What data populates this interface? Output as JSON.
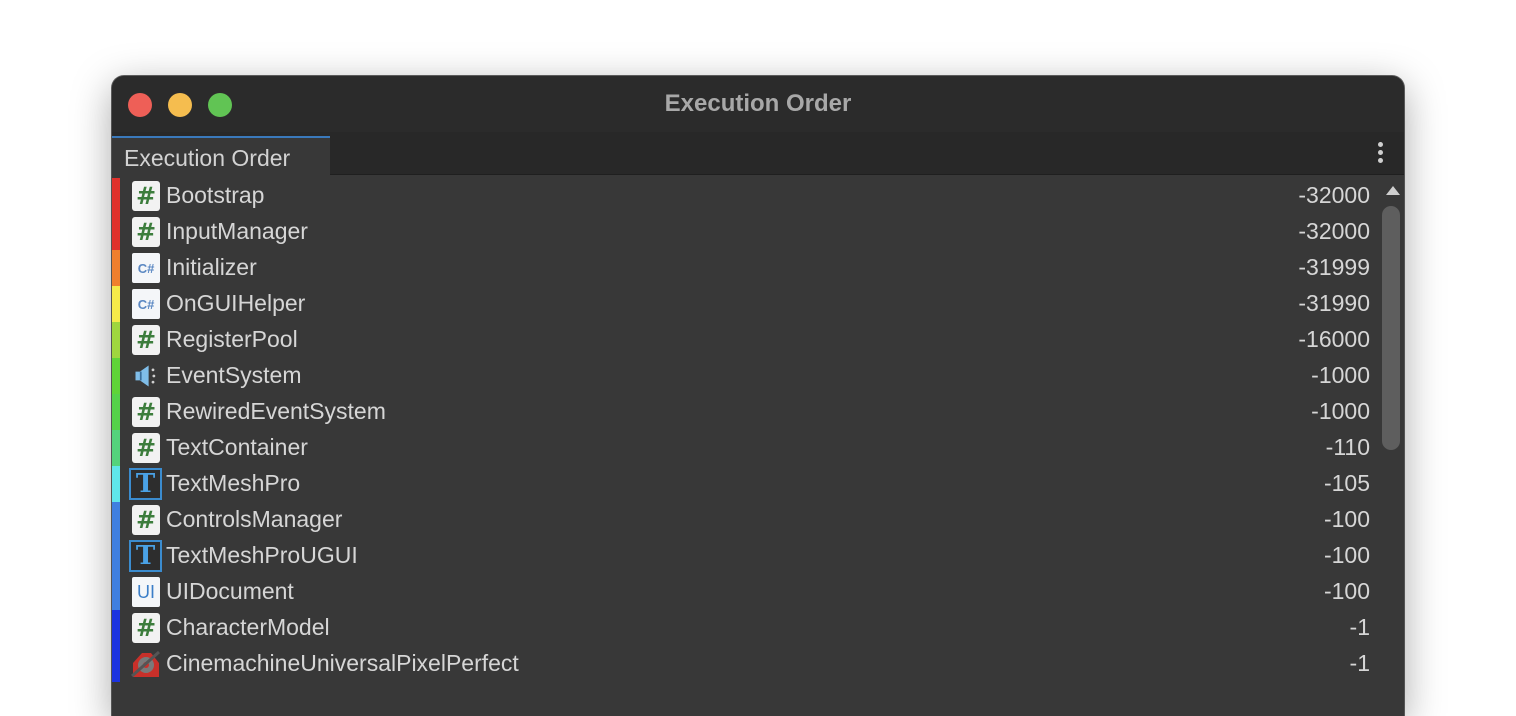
{
  "window": {
    "title": "Execution Order"
  },
  "tab": {
    "label": "Execution Order"
  },
  "scripts": [
    {
      "name": "Bootstrap",
      "order": "-32000",
      "icon": "script-hash-icon",
      "stripe": "#e0312c"
    },
    {
      "name": "InputManager",
      "order": "-32000",
      "icon": "script-hash-icon",
      "stripe": "#e0312c"
    },
    {
      "name": "Initializer",
      "order": "-31999",
      "icon": "csharp-file-icon",
      "stripe": "#f07f2d"
    },
    {
      "name": "OnGUIHelper",
      "order": "-31990",
      "icon": "csharp-file-icon",
      "stripe": "#f5ea4a"
    },
    {
      "name": "RegisterPool",
      "order": "-16000",
      "icon": "script-hash-icon",
      "stripe": "#9fd63e"
    },
    {
      "name": "EventSystem",
      "order": "-1000",
      "icon": "event-system-megaphone-icon",
      "stripe": "#5fd438"
    },
    {
      "name": "RewiredEventSystem",
      "order": "-1000",
      "icon": "script-hash-icon",
      "stripe": "#55d24a"
    },
    {
      "name": "TextContainer",
      "order": "-110",
      "icon": "script-hash-icon",
      "stripe": "#54d37c"
    },
    {
      "name": "TextMeshPro",
      "order": "-105",
      "icon": "textmeshpro-icon",
      "stripe": "#5fe6ea"
    },
    {
      "name": "ControlsManager",
      "order": "-100",
      "icon": "script-hash-icon",
      "stripe": "#3f7fe0"
    },
    {
      "name": "TextMeshProUGUI",
      "order": "-100",
      "icon": "textmeshpro-icon",
      "stripe": "#3f7fe0"
    },
    {
      "name": "UIDocument",
      "order": "-100",
      "icon": "ui-document-icon",
      "stripe": "#3f7fe0"
    },
    {
      "name": "CharacterModel",
      "order": "-1",
      "icon": "script-hash-icon",
      "stripe": "#1c33e0"
    },
    {
      "name": "CinemachineUniversalPixelPerfect",
      "order": "-1",
      "icon": "cinemachine-icon",
      "stripe": "#1c33e0"
    }
  ]
}
